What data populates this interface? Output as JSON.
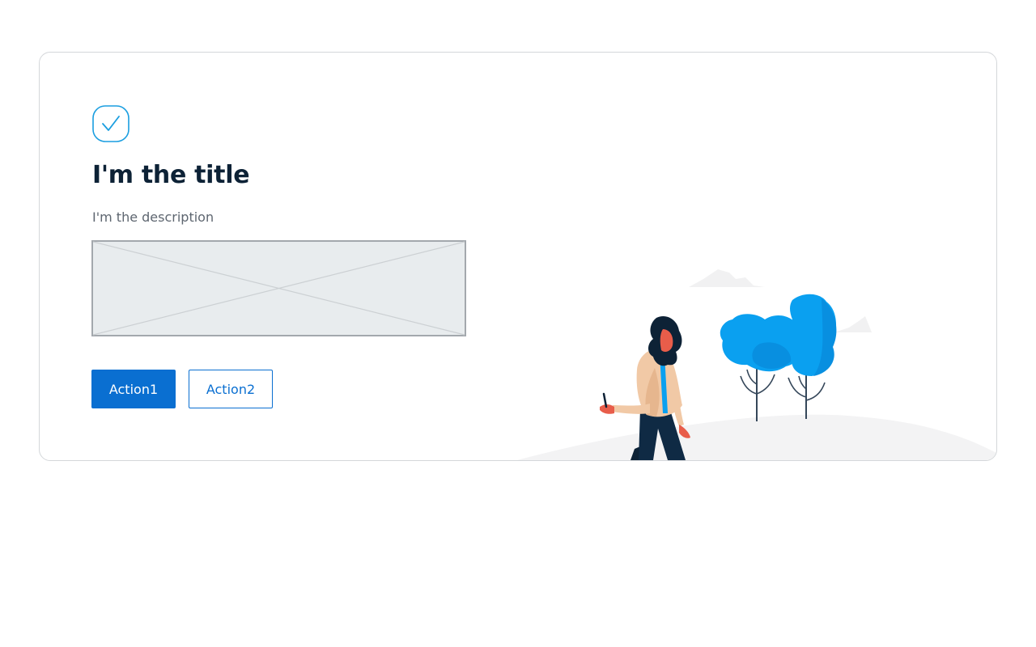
{
  "card": {
    "title": "I'm the title",
    "description": "I'm the description",
    "icon": "check-icon",
    "image_placeholder": "image-placeholder",
    "illustration": "woman-walking-with-phone-and-trees"
  },
  "actions": {
    "primary_label": "Action1",
    "secondary_label": "Action2"
  },
  "colors": {
    "accent": "#0a6fd1",
    "title": "#0d2236",
    "description": "#5e6670",
    "icon": "#1a9ee0",
    "tree": "#0aa0f0"
  }
}
